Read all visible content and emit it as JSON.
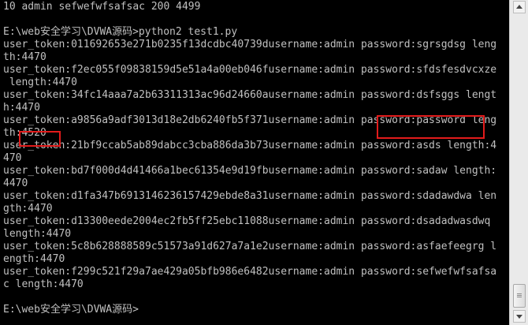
{
  "console": {
    "lines": [
      "10 admin sefwefwfsafsac 200 4499",
      "",
      "E:\\web安全学习\\DVWA源码>python2 test1.py",
      "user_token:011692653e271b0235f13dcdbc40739dusername:admin password:sgrsgdsg leng",
      "th:4470",
      "user_token:f2ec055f09838159d5e51a4a00eb046fusername:admin password:sfdsfesdvcxze",
      " length:4470",
      "user_token:34fc14aaa7a2b63311313ac96d24660ausername:admin password:dsfsggs lengt",
      "h:4470",
      "user_token:a9856a9adf3013d18e2db6240fb5f371username:admin password:password leng",
      "th:4520",
      "user_token:21bf9ccab5ab89dabcc3cba886da3b73username:admin password:asds length:4",
      "470",
      "user_token:bd7f000d4d41466a1bec61354e9d19fbusername:admin password:sadaw length:",
      "4470",
      "user_token:d1fa347b6913146236157429ebde8a31username:admin password:sdadawdwa len",
      "gth:4470",
      "user_token:d13300eede2004ec2fb5ff25ebc11088username:admin password:dsadadwasdwq",
      "length:4470",
      "user_token:5c8b628888589c51573a91d627a7a1e2username:admin password:asfaefeegrg l",
      "ength:4470",
      "user_token:f299c521f29a7ae429a05bfb986e6482username:admin password:sefwefwfsafsa",
      "c length:4470",
      "",
      "E:\\web安全学习\\DVWA源码>"
    ]
  },
  "colors": {
    "background": "#000000",
    "text": "#c0c0c0",
    "highlight": "#e21b1b"
  },
  "icons": {
    "scroll_up": "triangle-up-icon",
    "scroll_down": "triangle-down-icon"
  }
}
